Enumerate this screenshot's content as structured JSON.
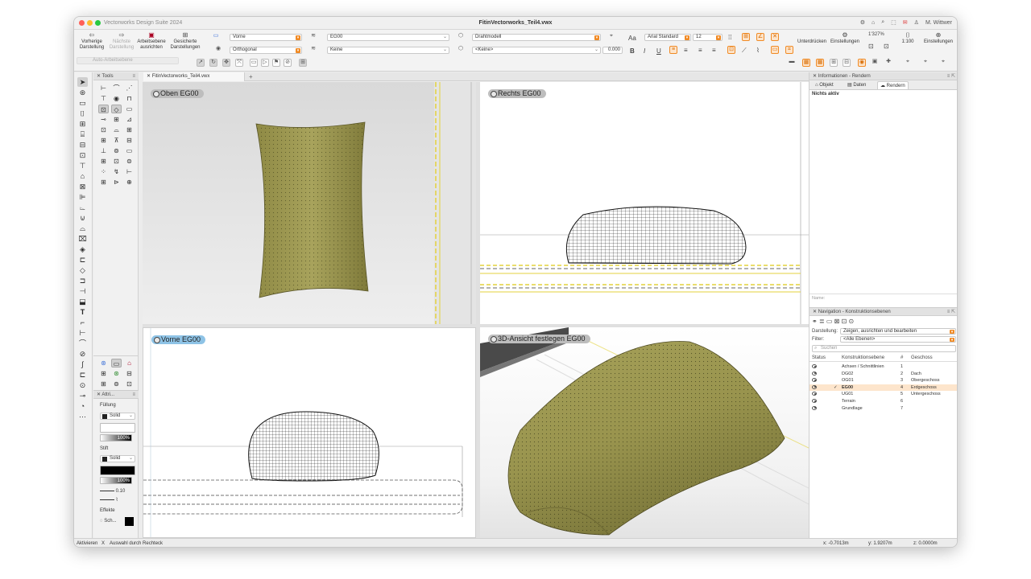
{
  "window": {
    "app_name": "Vectorworks Design Suite 2024",
    "doc_title": "FitinVectorworks_Teil4.vwx",
    "user": "M. Wittwer",
    "title_icons": [
      "gear-icon",
      "home-icon",
      "search-icon",
      "dotted-square-icon",
      "notification-icon",
      "user-icon"
    ]
  },
  "toolbar": {
    "prev_view": "Vorherige Darstellung",
    "next_view": "Nächste Darstellung",
    "align_layer": "Arbeitsebene ausrichten",
    "saved_views": "Gesicherte Darstellungen",
    "auto_plane": "Auto-Arbeitsebene",
    "view_select": "Vorne",
    "projection_select": "Orthogonal",
    "layer_select": "EG00",
    "class_select": "Keine",
    "render_select": "Drahtmodell",
    "render_sub_select": "<Keine>",
    "render_value": "0.000",
    "font_select": "Arial Standard",
    "font_size": "12",
    "suppress": "Unterdrücken",
    "settings": "Einstellungen",
    "zoom": "1'327%",
    "scale": "1:100",
    "settings2": "Einstellungen"
  },
  "tabs": {
    "doc_tab": "FitinVectorworks_Teil4.vwx",
    "add_tab": "+"
  },
  "tool_palette": {
    "icons": [
      "arrow-select-icon",
      "flyover-icon",
      "rectangle-icon",
      "door-icon",
      "window-icon",
      "stairs-icon",
      "wall-icon",
      "slab-icon",
      "column-icon",
      "roof-icon",
      "space-icon",
      "railing-icon",
      "beam-icon",
      "pipe-icon",
      "tank-icon",
      "cabinet-icon",
      "elevator-icon",
      "ramp-icon",
      "hole-icon",
      "wall-join-icon",
      "section-icon",
      "marker-icon",
      "tag-icon",
      "text-icon",
      "callout-icon",
      "dimension-icon",
      "polyline-icon",
      "circle-icon",
      "path-icon",
      "mirror-icon",
      "rotate-icon",
      "node-icon"
    ]
  },
  "toolsets": {
    "title": "Tools",
    "icons": [
      "dim-horizontal-icon",
      "curve-icon",
      "hatch-icon",
      "slope-icon",
      "eye-icon",
      "chair-icon",
      "sofa-icon",
      "counter-icon",
      "camera-icon",
      "wall-symbol-icon",
      "stair-symbol-icon",
      "door-symbol-icon",
      "shelf-icon",
      "door-swing-icon",
      "tape-icon",
      "label-icon",
      "toilet-icon",
      "dot-icon",
      "lamp-icon",
      "check-icon",
      "grid-icon",
      "target-icon"
    ]
  },
  "attributes": {
    "title": "Attri...",
    "fill_label": "Füllung",
    "fill_mode": "Solid",
    "fill_opacity": "100%",
    "pen_label": "Stift",
    "pen_mode": "Solid",
    "pen_opacity": "100%",
    "pen_weight": "0.10",
    "effects_label": "Effekte",
    "effects_value": "Sch..."
  },
  "viewports": {
    "top": "Oben  EG00",
    "right": "Rechts  EG00",
    "front": "Vorne  EG00",
    "perspective": "3D-Ansicht festlegen  EG00"
  },
  "info_palette": {
    "title": "Informationen - Rendern",
    "tabs": [
      "Objekt",
      "Daten",
      "Rendern"
    ],
    "empty_text": "Nichts aktiv",
    "name_label": "Name:"
  },
  "navigation": {
    "title": "Navigation - Konstruktionsebenen",
    "display_label": "Darstellung:",
    "display_value": "Zeigen, ausrichten und bearbeiten",
    "filter_label": "Filter:",
    "filter_value": "<Alle Ebenen>",
    "search_placeholder": "Suchen",
    "col_status": "Status",
    "col_layer": "Konstruktionsebene",
    "col_num": "#",
    "col_story": "Geschoss",
    "rows": [
      {
        "name": "Achsen / Schnittlinien",
        "num": "1",
        "story": ""
      },
      {
        "name": "DG02",
        "num": "2",
        "story": "Dach"
      },
      {
        "name": "OG01",
        "num": "3",
        "story": "Obergeschoss"
      },
      {
        "name": "EG00",
        "num": "4",
        "story": "Erdgeschoss",
        "active": true
      },
      {
        "name": "UG01",
        "num": "5",
        "story": "Untergeschoss"
      },
      {
        "name": "Terrain",
        "num": "6",
        "story": ""
      },
      {
        "name": "Grundlage",
        "num": "7",
        "story": ""
      }
    ]
  },
  "statusbar": {
    "mode": "Aktivieren",
    "close": "X",
    "hint": "Auswahl durch Rechteck",
    "x": "x: -0.7013m",
    "y": "y: 1.9207m",
    "z": "z: 0.0000m"
  },
  "colors": {
    "accent": "#f08a24",
    "cushion": "#a6a15a",
    "guide": "#e3d23c"
  }
}
